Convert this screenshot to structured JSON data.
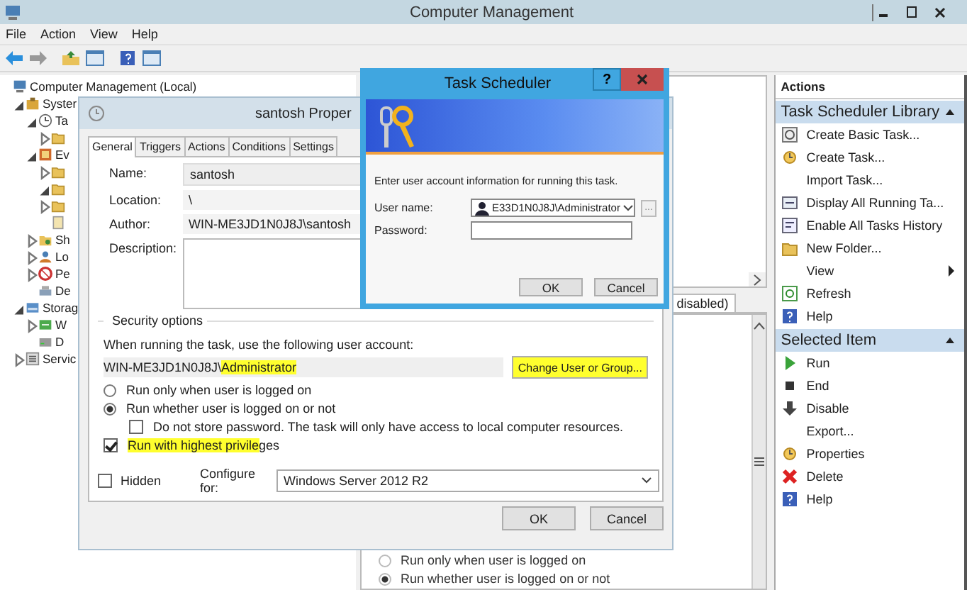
{
  "window": {
    "title": "Computer Management"
  },
  "menu": [
    {
      "label": "File"
    },
    {
      "label": "Action"
    },
    {
      "label": "View"
    },
    {
      "label": "Help"
    }
  ],
  "tree": [
    {
      "label": "Computer Management (Local)",
      "kind": "computer",
      "children": [
        {
          "label": "Syster",
          "kind": "tools",
          "expanded": true,
          "children": [
            {
              "label": "Ta",
              "kind": "clock",
              "expanded": true,
              "children": [
                {
                  "kind": "folder",
                  "expanded": false
                }
              ]
            },
            {
              "label": "Ev",
              "kind": "viewer",
              "expanded": true,
              "children": [
                {
                  "kind": "folder",
                  "expanded": false
                },
                {
                  "kind": "folder",
                  "expanded": true
                },
                {
                  "kind": "folder",
                  "expanded": false
                },
                {
                  "kind": "log"
                }
              ]
            },
            {
              "label": "Sh",
              "kind": "share",
              "expanded": false
            },
            {
              "label": "Lo",
              "kind": "users",
              "expanded": false
            },
            {
              "label": "Pe",
              "kind": "perf",
              "expanded": false
            },
            {
              "label": "De",
              "kind": "device"
            }
          ]
        },
        {
          "label": "Storag",
          "kind": "storage",
          "expanded": true,
          "children": [
            {
              "label": "W",
              "kind": "backup",
              "expanded": false
            },
            {
              "label": "D",
              "kind": "disk"
            }
          ]
        },
        {
          "label": "Servic",
          "kind": "services",
          "expanded": false
        }
      ]
    }
  ],
  "middle": {
    "tab_fragment": "disabled)",
    "options": [
      {
        "label": "Run only when user is logged on",
        "selected": false
      },
      {
        "label": "Run whether user is logged on or not",
        "selected": true
      }
    ]
  },
  "actions": {
    "title": "Actions",
    "sections": [
      {
        "title": "Task Scheduler Library",
        "expanded": true,
        "items": [
          {
            "label": "Create Basic Task...",
            "kind": "wizard"
          },
          {
            "label": "Create Task...",
            "kind": "task"
          },
          {
            "label": "Import Task..."
          },
          {
            "label": "Display All Running Ta...",
            "kind": "running"
          },
          {
            "label": "Enable All Tasks History",
            "kind": "history"
          },
          {
            "label": "New Folder...",
            "kind": "folder"
          },
          {
            "label": "View",
            "submenu": true
          },
          {
            "label": "Refresh",
            "kind": "refresh"
          },
          {
            "label": "Help",
            "kind": "help"
          }
        ]
      },
      {
        "title": "Selected Item",
        "expanded": true,
        "items": [
          {
            "label": "Run",
            "kind": "run"
          },
          {
            "label": "End",
            "kind": "end"
          },
          {
            "label": "Disable",
            "kind": "disable"
          },
          {
            "label": "Export..."
          },
          {
            "label": "Properties",
            "kind": "task"
          },
          {
            "label": "Delete",
            "kind": "delete"
          },
          {
            "label": "Help",
            "kind": "help"
          }
        ]
      }
    ]
  },
  "properties_dialog": {
    "title": "santosh Proper",
    "tabs": [
      {
        "label": "General",
        "selected": true
      },
      {
        "label": "Triggers",
        "selected": false
      },
      {
        "label": "Actions",
        "selected": false
      },
      {
        "label": "Conditions",
        "selected": false
      },
      {
        "label": "Settings",
        "selected": false
      }
    ],
    "fields": [
      {
        "label": "Name:",
        "value": "santosh",
        "kind": "input"
      },
      {
        "label": "Location:",
        "value": "\\",
        "kind": "readonly"
      },
      {
        "label": "Author:",
        "value": "WIN-ME3JD1N0J8J\\santosh",
        "kind": "readonly"
      },
      {
        "label": "Description:",
        "kind": "textarea"
      }
    ],
    "security": {
      "title": "Security options",
      "prompt": "When running the task, use the following user account:",
      "account": [
        {
          "text": "WIN-ME3JD1N0J8J\\",
          "highlighted": false
        },
        {
          "text": "Administrator",
          "highlighted": true
        }
      ],
      "change_button": {
        "label": "Change User or Group...",
        "highlighted": true
      },
      "options": [
        {
          "kind": "radio",
          "selected": false,
          "parts": [
            {
              "text": "Run only when user is logged on",
              "highlighted": false
            }
          ]
        },
        {
          "kind": "radio",
          "selected": true,
          "parts": [
            {
              "text": "Run whether user is logged on or not",
              "highlighted": false
            }
          ],
          "children": [
            {
              "kind": "checkbox",
              "checked": false,
              "parts": [
                {
                  "text": "Do not store password.  The task will only have access to local computer resources.",
                  "highlighted": false
                }
              ]
            }
          ]
        },
        {
          "kind": "checkbox",
          "checked": true,
          "parts": [
            {
              "text": "Run with highest privile",
              "highlighted": true
            },
            {
              "text": "ges",
              "highlighted": false
            }
          ]
        }
      ]
    },
    "hidden": {
      "label": "Hidden",
      "checked": false
    },
    "configure": {
      "label": "Configure for:",
      "value": "Windows Server 2012 R2"
    },
    "buttons": [
      {
        "label": "OK"
      },
      {
        "label": "Cancel"
      }
    ]
  },
  "task_dialog": {
    "title": "Task Scheduler",
    "help": "?",
    "prompt": "Enter user account information for running this task.",
    "user_label": "User name:",
    "user_value": "E33D1N0J8J\\Administrator",
    "browse": "...",
    "password_label": "Password:",
    "buttons": [
      {
        "label": "OK"
      },
      {
        "label": "Cancel"
      }
    ]
  }
}
